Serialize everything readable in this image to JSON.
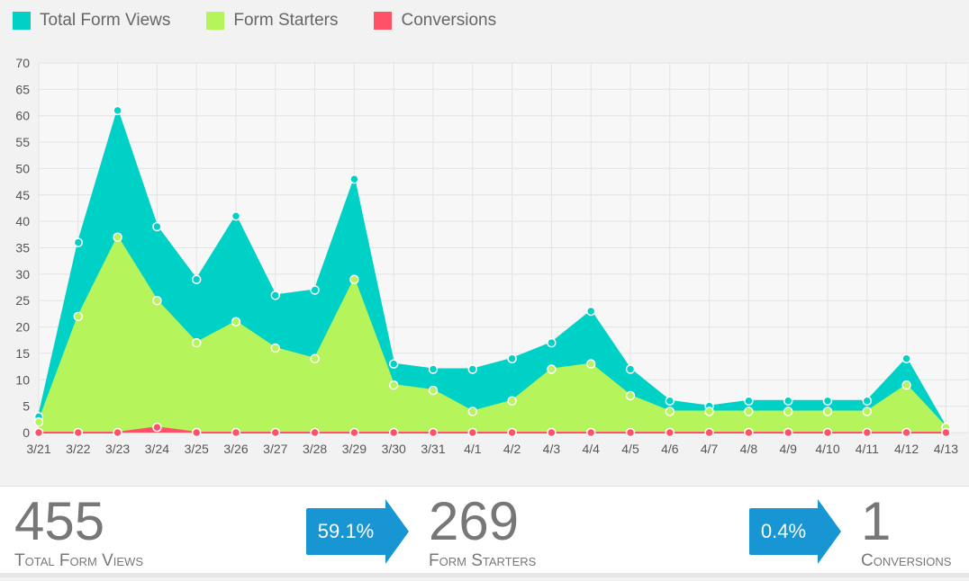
{
  "legend": [
    {
      "label": "Total Form Views",
      "color": "#00d1c6"
    },
    {
      "label": "Form Starters",
      "color": "#b5f45a"
    },
    {
      "label": "Conversions",
      "color": "#ff5266"
    }
  ],
  "chart_data": {
    "type": "area",
    "x": [
      "3/21",
      "3/22",
      "3/23",
      "3/24",
      "3/25",
      "3/26",
      "3/27",
      "3/28",
      "3/29",
      "3/30",
      "3/31",
      "4/1",
      "4/2",
      "4/3",
      "4/4",
      "4/5",
      "4/6",
      "4/7",
      "4/8",
      "4/9",
      "4/10",
      "4/11",
      "4/12",
      "4/13"
    ],
    "series": [
      {
        "name": "Total Form Views",
        "color": "#00d1c6",
        "values": [
          3,
          36,
          61,
          39,
          29,
          41,
          26,
          27,
          48,
          13,
          12,
          12,
          14,
          17,
          23,
          12,
          6,
          5,
          6,
          6,
          6,
          6,
          14,
          1
        ]
      },
      {
        "name": "Form Starters",
        "color": "#b5f45a",
        "values": [
          2,
          22,
          37,
          25,
          17,
          21,
          16,
          14,
          29,
          9,
          8,
          4,
          6,
          12,
          13,
          7,
          4,
          4,
          4,
          4,
          4,
          4,
          9,
          1
        ]
      },
      {
        "name": "Conversions",
        "color": "#ff5266",
        "values": [
          0,
          0,
          0,
          1,
          0,
          0,
          0,
          0,
          0,
          0,
          0,
          0,
          0,
          0,
          0,
          0,
          0,
          0,
          0,
          0,
          0,
          0,
          0,
          0
        ]
      }
    ],
    "yticks": [
      0,
      5,
      10,
      15,
      20,
      25,
      30,
      35,
      40,
      45,
      50,
      55,
      60,
      65,
      70
    ],
    "ylim": [
      0,
      70
    ],
    "grid": true,
    "legend_position": "top-left"
  },
  "summary": {
    "views": {
      "number": "455",
      "label": "Total Form Views"
    },
    "rate1": "59.1%",
    "starters": {
      "number": "269",
      "label": "Form Starters"
    },
    "rate2": "0.4%",
    "conversions": {
      "number": "1",
      "label": "Conversions"
    }
  }
}
